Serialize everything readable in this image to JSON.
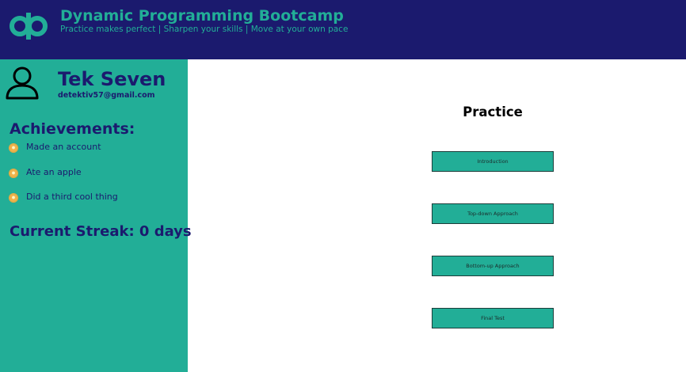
{
  "header": {
    "title": "Dynamic Programming Bootcamp",
    "tagline": "Practice makes perfect | Sharpen your skills | Move at your own pace",
    "logo_icon": "dp-logo-icon"
  },
  "profile": {
    "avatar_icon": "user-avatar-icon",
    "name": "Tek Seven",
    "email": "detektiv57@gmail.com"
  },
  "achievements": {
    "heading": "Achievements:",
    "bullet_icon": "medal-icon",
    "items": [
      {
        "label": "Made an account"
      },
      {
        "label": "Ate an apple"
      },
      {
        "label": "Did a third cool thing"
      }
    ]
  },
  "streak": {
    "text": "Current Streak: 0 days"
  },
  "practice": {
    "title": "Practice",
    "buttons": [
      {
        "label": "Introduction"
      },
      {
        "label": "Top-down Approach"
      },
      {
        "label": "Bottom-up Approach"
      },
      {
        "label": "Final Test"
      }
    ]
  },
  "colors": {
    "navy": "#1b1a6e",
    "teal": "#22ae97",
    "white": "#ffffff"
  }
}
